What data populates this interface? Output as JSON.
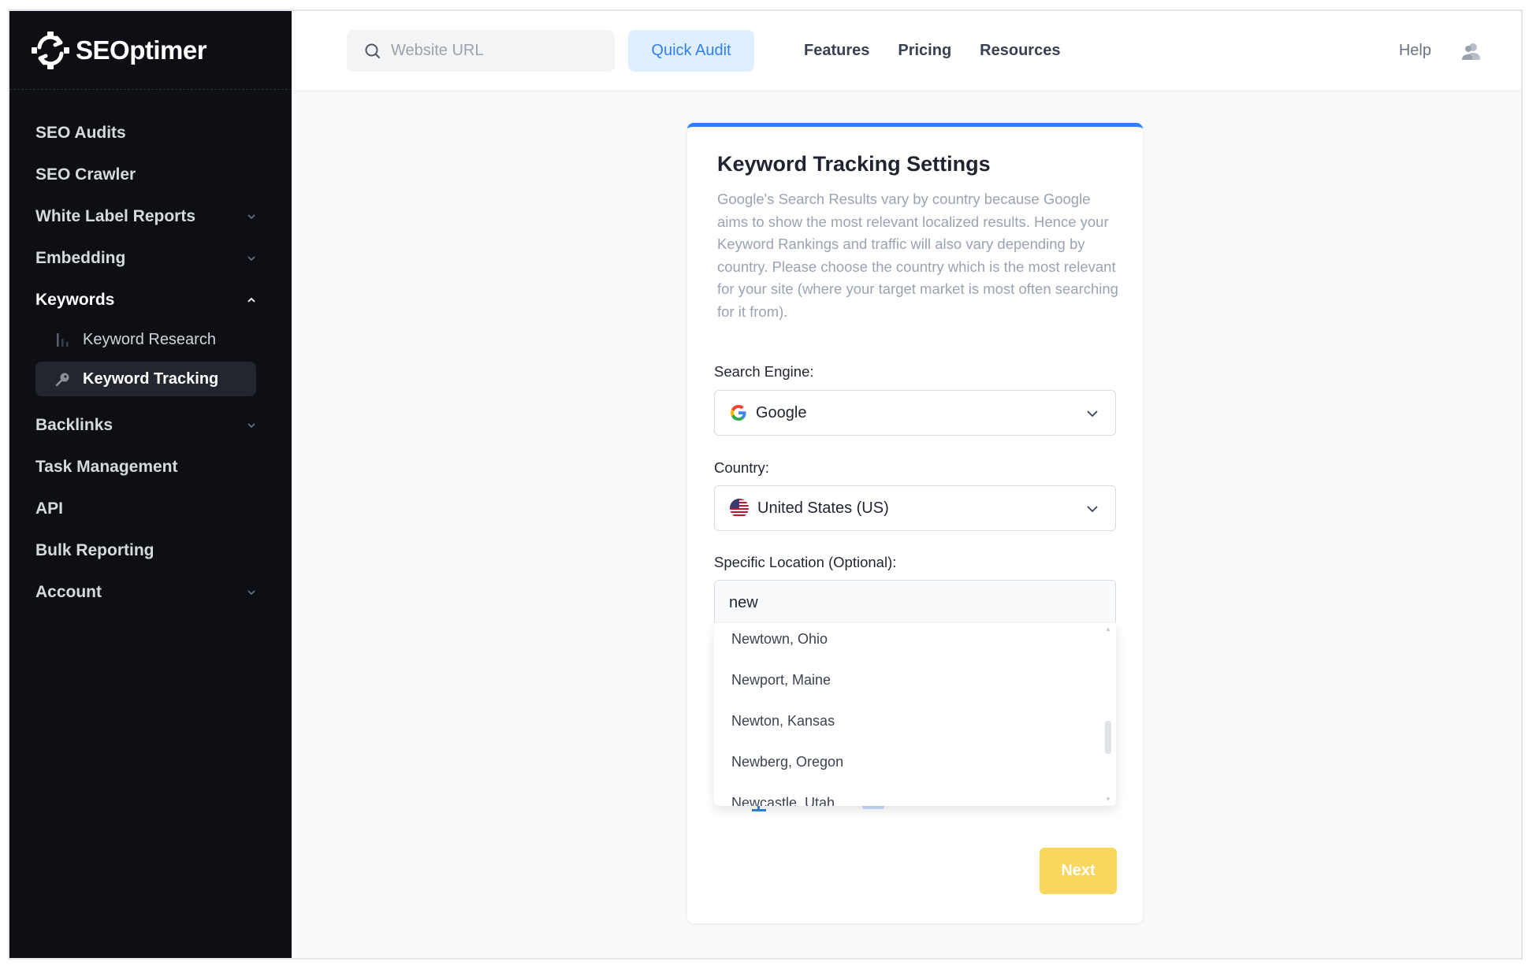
{
  "app": {
    "name": "SEOptimer"
  },
  "sidebar": {
    "items": [
      {
        "label": "SEO Audits",
        "has_chevron": false
      },
      {
        "label": "SEO Crawler",
        "has_chevron": false
      },
      {
        "label": "White Label Reports",
        "has_chevron": true
      },
      {
        "label": "Embedding",
        "has_chevron": true
      },
      {
        "label": "Keywords",
        "has_chevron": true,
        "expanded": true
      },
      {
        "label": "Backlinks",
        "has_chevron": true
      },
      {
        "label": "Task Management",
        "has_chevron": false
      },
      {
        "label": "API",
        "has_chevron": false
      },
      {
        "label": "Bulk Reporting",
        "has_chevron": false
      },
      {
        "label": "Account",
        "has_chevron": true
      }
    ],
    "keywords_sub": [
      {
        "label": "Keyword Research",
        "icon": "bar-chart-icon",
        "selected": false
      },
      {
        "label": "Keyword Tracking",
        "icon": "key-icon",
        "selected": true
      }
    ]
  },
  "topbar": {
    "search_placeholder": "Website URL",
    "quick_audit": "Quick Audit",
    "nav": [
      "Features",
      "Pricing",
      "Resources"
    ],
    "help": "Help"
  },
  "card": {
    "title": "Keyword Tracking Settings",
    "description": "Google's Search Results vary by country because Google aims to show the most relevant localized results. Hence your Keyword Rankings and traffic will also vary depending by country. Please choose the country which is the most relevant for your site (where your target market is most often searching for it from).",
    "search_engine_label": "Search Engine:",
    "search_engine_value": "Google",
    "country_label": "Country:",
    "country_value": "United States (US)",
    "location_label": "Specific Location (Optional):",
    "location_value": "new",
    "location_suggestions": [
      "Newtown, Ohio",
      "Newport, Maine",
      "Newton, Kansas",
      "Newberg, Oregon",
      "Newcastle, Utah"
    ],
    "next_button": "Next"
  },
  "colors": {
    "sidebar_bg": "#0d0f14",
    "accent": "#2d7ff9",
    "quick_audit_bg": "#e0efff",
    "next_bg": "#f9d65c"
  }
}
